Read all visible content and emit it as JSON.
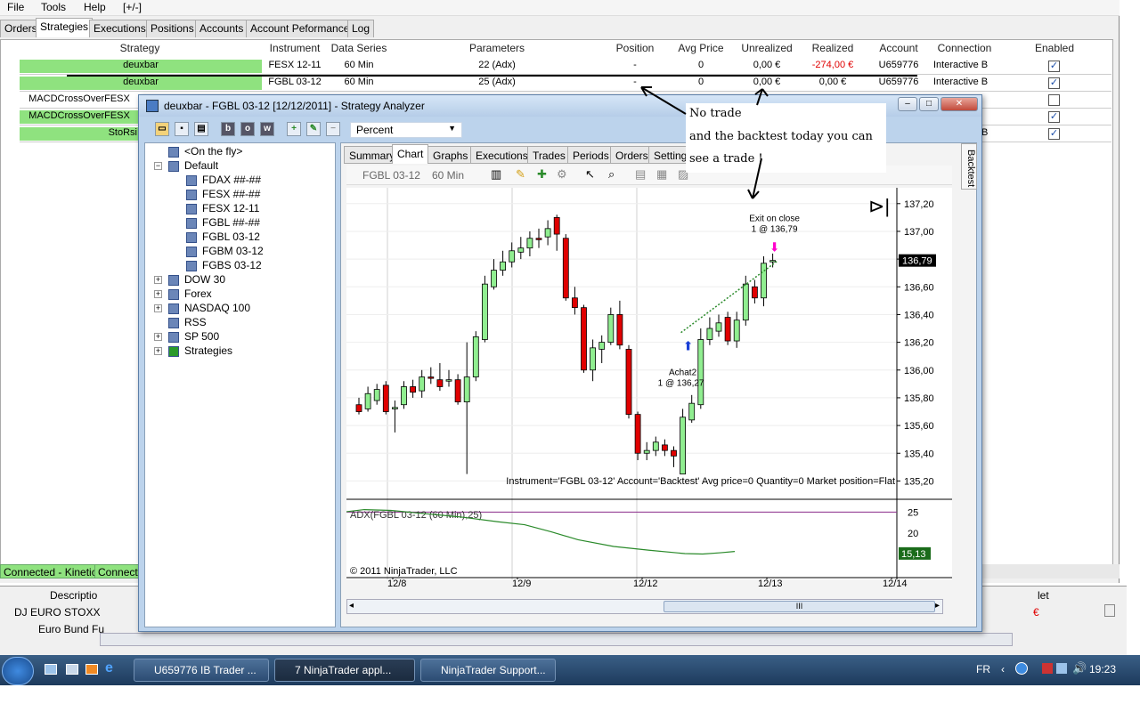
{
  "menu": {
    "file": "File",
    "tools": "Tools",
    "help": "Help",
    "expand": "[+/-]"
  },
  "main_tabs": [
    "Orders",
    "Strategies",
    "Executions",
    "Positions",
    "Accounts",
    "Account Peformance",
    "Log"
  ],
  "strategies_table": {
    "headers": [
      "Strategy",
      "Instrument",
      "Data Series",
      "Parameters",
      "Position",
      "Avg Price",
      "Unrealized",
      "Realized",
      "Account",
      "Connection",
      "Enabled"
    ],
    "rows": [
      {
        "strategy": "deuxbar",
        "instrument": "FESX 12-11",
        "data_series": "60 Min",
        "parameters": "22 (Adx)",
        "position": "-",
        "avg_price": "0",
        "unrealized": "0,00 €",
        "realized": "-274,00 €",
        "account": "U659776",
        "connection": "Interactive B",
        "enabled": "✓"
      },
      {
        "strategy": "deuxbar",
        "instrument": "FGBL 03-12",
        "data_series": "60 Min",
        "parameters": "25 (Adx)",
        "position": "-",
        "avg_price": "0",
        "unrealized": "0,00 €",
        "realized": "0,00 €",
        "account": "U659776",
        "connection": "Interactive B",
        "enabled": "✓"
      },
      {
        "strategy": "MACDCrossOverFESX",
        "enabled": ""
      },
      {
        "strategy": "MACDCrossOverFESX",
        "enabled": "✓"
      },
      {
        "strategy": "StoRsi",
        "connection": "B",
        "enabled": "✓"
      }
    ]
  },
  "status": {
    "conn1": "Connected - Kinetick",
    "conn2": "Connecte"
  },
  "lower_window": {
    "header_description": "Descriptio",
    "row1": "DJ EURO STOXX",
    "row2": "Euro Bund Fu",
    "right_header": "let",
    "right_red": "€"
  },
  "analyzer": {
    "title": "deuxbar - FGBL 03-12 [12/12/2011] - Strategy Analyzer",
    "percent_dropdown": "Percent",
    "toolbar_letters": [
      "b",
      "o",
      "w"
    ],
    "tree": [
      {
        "label": "<On the fly>",
        "level": 1,
        "exp": ""
      },
      {
        "label": "Default",
        "level": 0,
        "exp": "−"
      },
      {
        "label": "FDAX ##-##",
        "level": 2,
        "exp": ""
      },
      {
        "label": "FESX ##-##",
        "level": 2,
        "exp": ""
      },
      {
        "label": "FESX 12-11",
        "level": 2,
        "exp": ""
      },
      {
        "label": "FGBL ##-##",
        "level": 2,
        "exp": ""
      },
      {
        "label": "FGBL 03-12",
        "level": 2,
        "exp": ""
      },
      {
        "label": "FGBM 03-12",
        "level": 2,
        "exp": ""
      },
      {
        "label": "FGBS 03-12",
        "level": 2,
        "exp": ""
      },
      {
        "label": "DOW 30",
        "level": 0,
        "exp": "+"
      },
      {
        "label": "Forex",
        "level": 0,
        "exp": "+"
      },
      {
        "label": "NASDAQ 100",
        "level": 0,
        "exp": "+"
      },
      {
        "label": "RSS",
        "level": 1,
        "exp": ""
      },
      {
        "label": "SP 500",
        "level": 0,
        "exp": "+"
      },
      {
        "label": "Strategies",
        "level": 0,
        "exp": "+"
      }
    ],
    "subtabs": [
      "Summary",
      "Chart",
      "Graphs",
      "Executions",
      "Trades",
      "Periods",
      "Orders",
      "Settings"
    ],
    "side_tab": "Backtest",
    "chart_toolbar": {
      "instrument": "FGBL 03-12",
      "period": "60 Min"
    },
    "scroll_label": "III"
  },
  "chart": {
    "info_line": "Instrument='FGBL 03-12' Account='Backtest' Avg price=0 Quantity=0 Market position=Flat",
    "indicator_label": "ADX(FGBL 03-12 (60 Min),25)",
    "copyright": "© 2011 NinjaTrader, LLC",
    "exit_label_1": "Exit on close",
    "exit_label_2": "1 @ 136,79",
    "entry_label_1": "Achat2",
    "entry_label_2": "1 @ 136,27",
    "last_price": "136,79",
    "adx_value": "15,13",
    "y_ticks": [
      "137,20",
      "137,00",
      "136,80",
      "136,60",
      "136,40",
      "136,20",
      "136,00",
      "135,80",
      "135,60",
      "135,40",
      "135,20"
    ],
    "adx_ticks": [
      "25",
      "20"
    ],
    "x_ticks": [
      "12/8",
      "12/9",
      "12/12",
      "12/13",
      "12/14"
    ],
    "colors": {
      "up": "#90ee90",
      "down": "#e00000",
      "adx": "#2a8a2a",
      "exit": "#ff00cc",
      "entry": "#1a3fd6"
    }
  },
  "annotation": {
    "line1": "No trade",
    "line2": "and the backtest today you can",
    "line3": "see a trade !"
  },
  "taskbar": {
    "tasks": [
      "U659776 IB Trader ...",
      "7 NinjaTrader appl...",
      "NinjaTrader Support..."
    ],
    "lang": "FR",
    "clock": "19:23"
  }
}
